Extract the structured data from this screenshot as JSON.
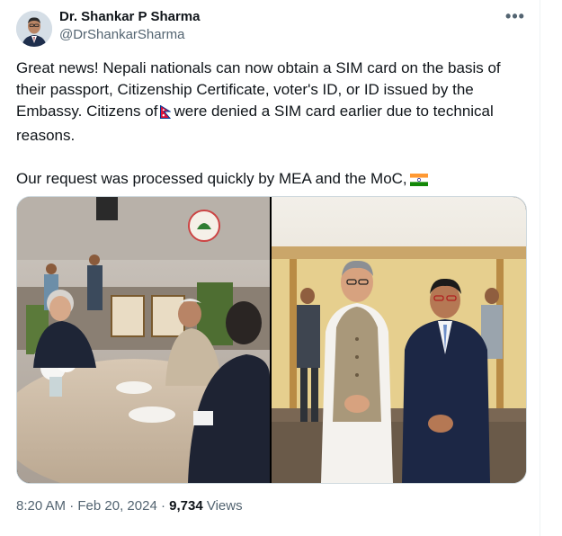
{
  "author": {
    "name": "Dr. Shankar P Sharma",
    "handle": "@DrShankarSharma"
  },
  "tweet": {
    "para1_a": "Great news! Nepali nationals can now obtain a SIM card on the basis of their passport, Citizenship Certificate, voter's ID, or ID issued by the Embassy. Citizens of",
    "para1_b": "were denied a SIM card earlier due to technical reasons.",
    "para2": "Our request was processed quickly by MEA and the MoC,",
    "flag_1": "nepal-flag-emoji",
    "flag_2": "india-flag-emoji"
  },
  "media": {
    "left_photo": "meeting-table-photo",
    "right_photo": "two-men-standing-photo"
  },
  "meta": {
    "time": "8:20 AM",
    "sep1": "·",
    "date": "Feb 20, 2024",
    "sep2": "·",
    "views_count": "9,734",
    "views_label": "Views"
  },
  "more_icon": "more-options-icon"
}
